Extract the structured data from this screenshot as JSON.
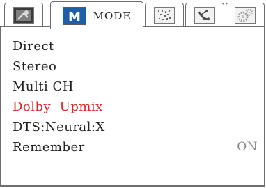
{
  "tabs": [
    {
      "id": "speaker",
      "icon": "speaker-settings-icon"
    },
    {
      "id": "mode",
      "icon": "mode-m-icon",
      "label": "MODE"
    },
    {
      "id": "dsp",
      "icon": "dsp-pattern-icon"
    },
    {
      "id": "setup",
      "icon": "satellite-dish-icon"
    },
    {
      "id": "system",
      "icon": "gears-icon"
    }
  ],
  "menu": {
    "items": [
      {
        "label": "Direct"
      },
      {
        "label": "Stereo"
      },
      {
        "label": "Multi CH"
      },
      {
        "label": "Dolby  Upmix",
        "selected": true
      },
      {
        "label": "DTS:Neural:X"
      },
      {
        "label": "Remember",
        "value": "ON"
      }
    ]
  },
  "colors": {
    "selected": "#e0262a",
    "text": "#222222",
    "value": "#8a8a8a",
    "border": "#6e6e6e"
  }
}
